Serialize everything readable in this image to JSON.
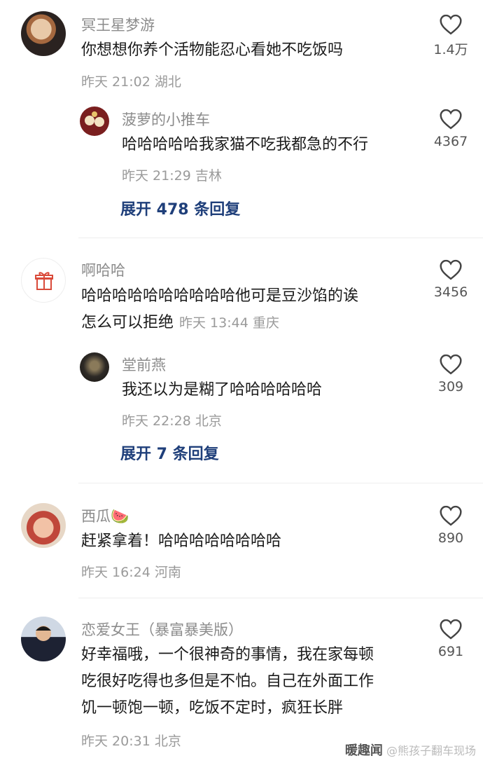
{
  "comments": [
    {
      "name": "冥王星梦游",
      "text": "你想想你养个活物能忍心看她不吃饭吗",
      "meta": "昨天 21:02 湖北",
      "likes": "1.4万",
      "reply": {
        "name": "菠萝的小推车",
        "text": "哈哈哈哈哈我家猫不吃我都急的不行",
        "meta": "昨天 21:29 吉林",
        "likes": "4367"
      },
      "expand": "展开 478 条回复"
    },
    {
      "name": "啊哈哈",
      "text_line1": "哈哈哈哈哈哈哈哈哈哈他可是豆沙馅的诶",
      "text_line2": "怎么可以拒绝",
      "meta": "昨天 13:44 重庆",
      "likes": "3456",
      "reply": {
        "name": "堂前燕",
        "text": "我还以为是糊了哈哈哈哈哈哈",
        "meta": "昨天 22:28 北京",
        "likes": "309"
      },
      "expand": "展开 7 条回复"
    },
    {
      "name": "西瓜🍉",
      "text": "赶紧拿着！哈哈哈哈哈哈哈哈",
      "meta": "昨天 16:24 河南",
      "likes": "890"
    },
    {
      "name": "恋爱女王（暴富暴美版）",
      "text_line1": "好幸福哦，一个很神奇的事情，我在家每顿",
      "text_line2": "吃很好吃得也多但是不怕。自己在外面工作",
      "text_line3": "饥一顿饱一顿，吃饭不定时，疯狂长胖",
      "meta": "昨天 20:31 北京",
      "likes": "691"
    }
  ],
  "watermark": {
    "brand": "暖趣闻",
    "source": "@熊孩子翻车现场"
  },
  "colors": {
    "link": "#1f3f7a",
    "meta": "#9a9a9a",
    "name": "#8c8c8c"
  }
}
